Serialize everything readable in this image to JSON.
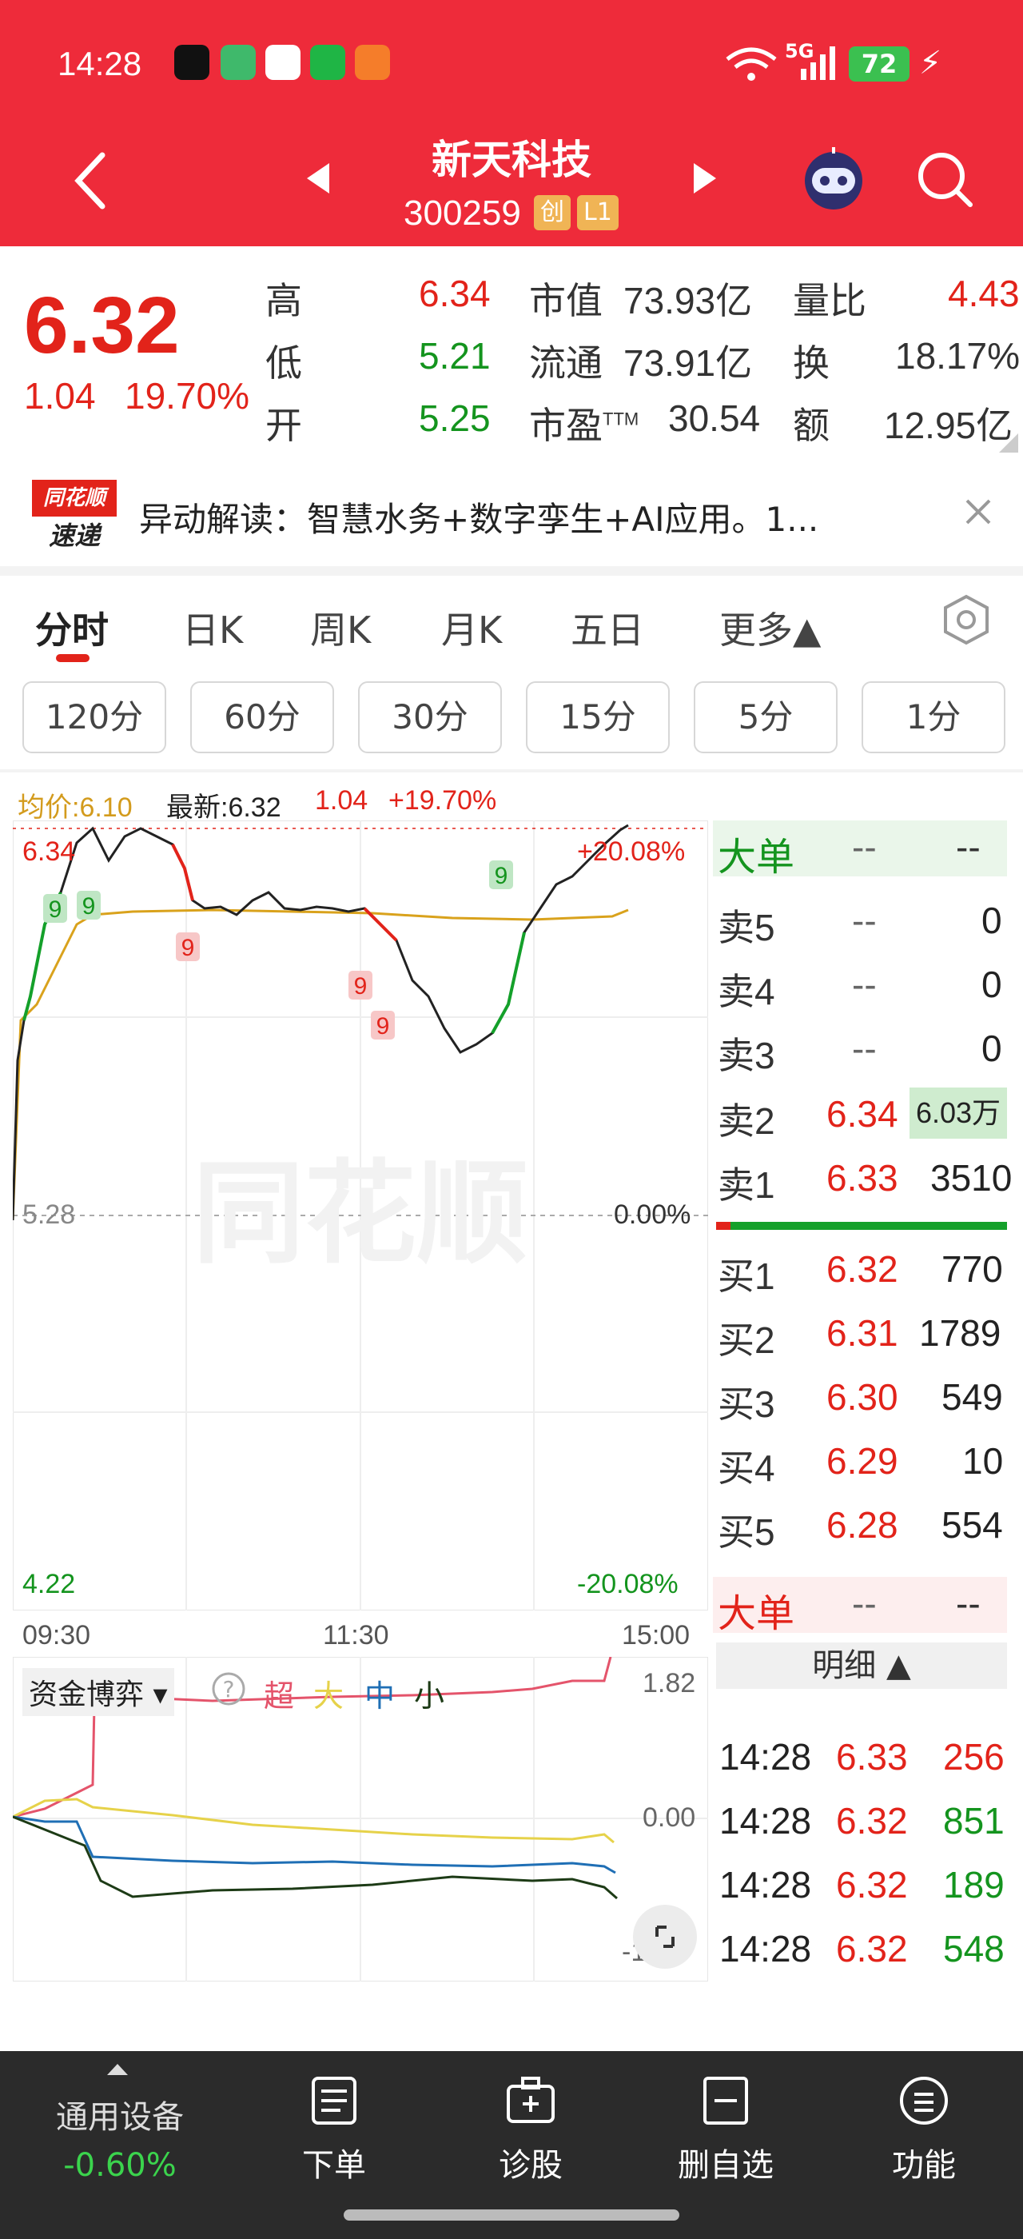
{
  "status_bar": {
    "time": "14:28",
    "battery": "72",
    "network": "5G"
  },
  "header": {
    "title": "新天科技",
    "code": "300259",
    "badge_chuang": "创",
    "badge_level": "L1"
  },
  "quote": {
    "price": "6.32",
    "change": "1.04",
    "change_pct": "19.70%",
    "high_label": "高",
    "high": "6.34",
    "low_label": "低",
    "low": "5.21",
    "open_label": "开",
    "open": "5.25",
    "mcap_label": "市值",
    "mcap": "73.93亿",
    "float_label": "流通",
    "float": "73.91亿",
    "pe_label": "市盈TTM",
    "pe": "30.54",
    "vr_label": "量比",
    "vr": "4.43",
    "turnover_label": "换",
    "turnover": "18.17%",
    "amount_label": "额",
    "amount": "12.95亿"
  },
  "news": {
    "logo_top": "同花顺",
    "logo_bottom": "速递",
    "text": "异动解读：智慧水务+数字孪生+AI应用。1..."
  },
  "tabs": [
    "分时",
    "日K",
    "周K",
    "月K",
    "五日",
    "更多▲"
  ],
  "intervals": [
    "120分",
    "60分",
    "30分",
    "15分",
    "5分",
    "1分"
  ],
  "chart": {
    "avg_label": "均价:6.10",
    "latest_label": "最新:6.32",
    "chg": "1.04",
    "chg_pct": "+19.70%",
    "y_top": "6.34",
    "y_top_pct": "+20.08%",
    "y_mid": "5.28",
    "y_mid_pct": "0.00%",
    "y_bot": "4.22",
    "y_bot_pct": "-20.08%",
    "x_start": "09:30",
    "x_mid": "11:30",
    "x_end": "15:00",
    "markers": [
      "9",
      "9",
      "9",
      "9",
      "9",
      "9"
    ],
    "watermark": "同花顺"
  },
  "fund": {
    "title": "资金博弈",
    "super": "超",
    "big": "大",
    "mid": "中",
    "small": "小",
    "top": "1.82",
    "zero": "0.00",
    "bot": "-1.82"
  },
  "orderbook": {
    "big_label": "大单",
    "dash": "--",
    "sells": [
      {
        "label": "卖5",
        "price": "--",
        "vol": "0"
      },
      {
        "label": "卖4",
        "price": "--",
        "vol": "0"
      },
      {
        "label": "卖3",
        "price": "--",
        "vol": "0"
      },
      {
        "label": "卖2",
        "price": "6.34",
        "vol": "6.03万"
      },
      {
        "label": "卖1",
        "price": "6.33",
        "vol": "3510"
      }
    ],
    "buys": [
      {
        "label": "买1",
        "price": "6.32",
        "vol": "770"
      },
      {
        "label": "买2",
        "price": "6.31",
        "vol": "1789"
      },
      {
        "label": "买3",
        "price": "6.30",
        "vol": "549"
      },
      {
        "label": "买4",
        "price": "6.29",
        "vol": "10"
      },
      {
        "label": "买5",
        "price": "6.28",
        "vol": "554"
      }
    ],
    "detail_label": "明细 ▲",
    "ticks": [
      {
        "time": "14:28",
        "price": "6.33",
        "vol": "256"
      },
      {
        "time": "14:28",
        "price": "6.32",
        "vol": "851"
      },
      {
        "time": "14:28",
        "price": "6.32",
        "vol": "189"
      },
      {
        "time": "14:28",
        "price": "6.32",
        "vol": "548"
      }
    ]
  },
  "bottom_nav": {
    "sector_name": "通用设备",
    "sector_pct": "-0.60%",
    "items": [
      "下单",
      "诊股",
      "删自选",
      "功能"
    ]
  }
}
